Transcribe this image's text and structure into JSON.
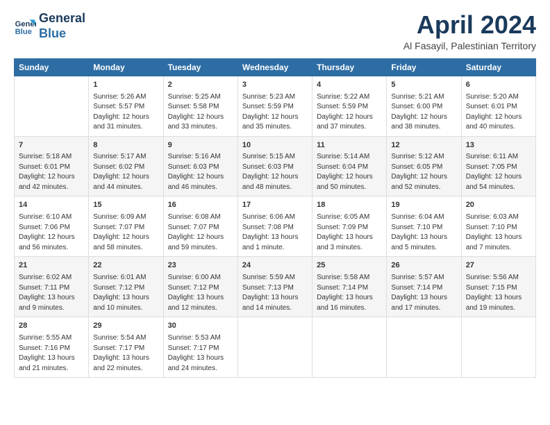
{
  "logo": {
    "line1": "General",
    "line2": "Blue"
  },
  "title": "April 2024",
  "subtitle": "Al Fasayil, Palestinian Territory",
  "headers": [
    "Sunday",
    "Monday",
    "Tuesday",
    "Wednesday",
    "Thursday",
    "Friday",
    "Saturday"
  ],
  "weeks": [
    [
      {
        "date": "",
        "content": ""
      },
      {
        "date": "1",
        "content": "Sunrise: 5:26 AM\nSunset: 5:57 PM\nDaylight: 12 hours\nand 31 minutes."
      },
      {
        "date": "2",
        "content": "Sunrise: 5:25 AM\nSunset: 5:58 PM\nDaylight: 12 hours\nand 33 minutes."
      },
      {
        "date": "3",
        "content": "Sunrise: 5:23 AM\nSunset: 5:59 PM\nDaylight: 12 hours\nand 35 minutes."
      },
      {
        "date": "4",
        "content": "Sunrise: 5:22 AM\nSunset: 5:59 PM\nDaylight: 12 hours\nand 37 minutes."
      },
      {
        "date": "5",
        "content": "Sunrise: 5:21 AM\nSunset: 6:00 PM\nDaylight: 12 hours\nand 38 minutes."
      },
      {
        "date": "6",
        "content": "Sunrise: 5:20 AM\nSunset: 6:01 PM\nDaylight: 12 hours\nand 40 minutes."
      }
    ],
    [
      {
        "date": "7",
        "content": "Sunrise: 5:18 AM\nSunset: 6:01 PM\nDaylight: 12 hours\nand 42 minutes."
      },
      {
        "date": "8",
        "content": "Sunrise: 5:17 AM\nSunset: 6:02 PM\nDaylight: 12 hours\nand 44 minutes."
      },
      {
        "date": "9",
        "content": "Sunrise: 5:16 AM\nSunset: 6:03 PM\nDaylight: 12 hours\nand 46 minutes."
      },
      {
        "date": "10",
        "content": "Sunrise: 5:15 AM\nSunset: 6:03 PM\nDaylight: 12 hours\nand 48 minutes."
      },
      {
        "date": "11",
        "content": "Sunrise: 5:14 AM\nSunset: 6:04 PM\nDaylight: 12 hours\nand 50 minutes."
      },
      {
        "date": "12",
        "content": "Sunrise: 5:12 AM\nSunset: 6:05 PM\nDaylight: 12 hours\nand 52 minutes."
      },
      {
        "date": "13",
        "content": "Sunrise: 6:11 AM\nSunset: 7:05 PM\nDaylight: 12 hours\nand 54 minutes."
      }
    ],
    [
      {
        "date": "14",
        "content": "Sunrise: 6:10 AM\nSunset: 7:06 PM\nDaylight: 12 hours\nand 56 minutes."
      },
      {
        "date": "15",
        "content": "Sunrise: 6:09 AM\nSunset: 7:07 PM\nDaylight: 12 hours\nand 58 minutes."
      },
      {
        "date": "16",
        "content": "Sunrise: 6:08 AM\nSunset: 7:07 PM\nDaylight: 12 hours\nand 59 minutes."
      },
      {
        "date": "17",
        "content": "Sunrise: 6:06 AM\nSunset: 7:08 PM\nDaylight: 13 hours\nand 1 minute."
      },
      {
        "date": "18",
        "content": "Sunrise: 6:05 AM\nSunset: 7:09 PM\nDaylight: 13 hours\nand 3 minutes."
      },
      {
        "date": "19",
        "content": "Sunrise: 6:04 AM\nSunset: 7:10 PM\nDaylight: 13 hours\nand 5 minutes."
      },
      {
        "date": "20",
        "content": "Sunrise: 6:03 AM\nSunset: 7:10 PM\nDaylight: 13 hours\nand 7 minutes."
      }
    ],
    [
      {
        "date": "21",
        "content": "Sunrise: 6:02 AM\nSunset: 7:11 PM\nDaylight: 13 hours\nand 9 minutes."
      },
      {
        "date": "22",
        "content": "Sunrise: 6:01 AM\nSunset: 7:12 PM\nDaylight: 13 hours\nand 10 minutes."
      },
      {
        "date": "23",
        "content": "Sunrise: 6:00 AM\nSunset: 7:12 PM\nDaylight: 13 hours\nand 12 minutes."
      },
      {
        "date": "24",
        "content": "Sunrise: 5:59 AM\nSunset: 7:13 PM\nDaylight: 13 hours\nand 14 minutes."
      },
      {
        "date": "25",
        "content": "Sunrise: 5:58 AM\nSunset: 7:14 PM\nDaylight: 13 hours\nand 16 minutes."
      },
      {
        "date": "26",
        "content": "Sunrise: 5:57 AM\nSunset: 7:14 PM\nDaylight: 13 hours\nand 17 minutes."
      },
      {
        "date": "27",
        "content": "Sunrise: 5:56 AM\nSunset: 7:15 PM\nDaylight: 13 hours\nand 19 minutes."
      }
    ],
    [
      {
        "date": "28",
        "content": "Sunrise: 5:55 AM\nSunset: 7:16 PM\nDaylight: 13 hours\nand 21 minutes."
      },
      {
        "date": "29",
        "content": "Sunrise: 5:54 AM\nSunset: 7:17 PM\nDaylight: 13 hours\nand 22 minutes."
      },
      {
        "date": "30",
        "content": "Sunrise: 5:53 AM\nSunset: 7:17 PM\nDaylight: 13 hours\nand 24 minutes."
      },
      {
        "date": "",
        "content": ""
      },
      {
        "date": "",
        "content": ""
      },
      {
        "date": "",
        "content": ""
      },
      {
        "date": "",
        "content": ""
      }
    ]
  ]
}
